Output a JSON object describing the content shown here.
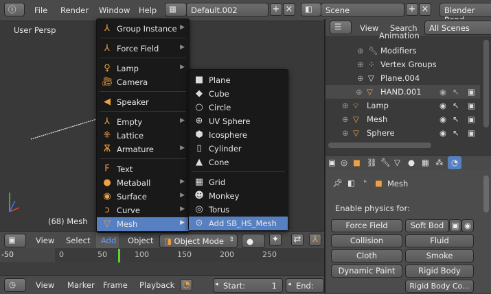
{
  "topbar": {
    "menus": [
      "File",
      "Render",
      "Window",
      "Help"
    ],
    "layout_field": "Default.002",
    "scene_field": "Scene",
    "engine_field": "Blender Rend"
  },
  "viewport": {
    "view_label": "User Persp",
    "object_label": "(68) Mesh"
  },
  "view_header": {
    "items": [
      "View",
      "Select",
      "Add",
      "Object"
    ],
    "mode": "Object Mode"
  },
  "timeline": {
    "ticks": [
      "-50",
      "0",
      "50",
      "100",
      "150",
      "200",
      "250"
    ],
    "current_frame_marker": 68,
    "footer_items": [
      "View",
      "Marker",
      "Frame",
      "Playback"
    ],
    "start_label": "Start:",
    "start_value": "1",
    "end_label": "End:"
  },
  "outliner": {
    "header_items": [
      "View",
      "Search"
    ],
    "scope": "All Scenes",
    "rows": [
      {
        "label": "Animation",
        "icon": "animation-icon"
      },
      {
        "label": "Modifiers",
        "icon": "wrench-icon"
      },
      {
        "label": "Vertex Groups",
        "icon": "vertex-groups-icon"
      },
      {
        "label": "Plane.004",
        "icon": "mesh-icon"
      },
      {
        "label": "HAND.001",
        "icon": "mesh-icon"
      },
      {
        "label": "Lamp",
        "icon": "lamp-icon"
      },
      {
        "label": "Mesh",
        "icon": "mesh-icon"
      },
      {
        "label": "Sphere",
        "icon": "mesh-icon"
      }
    ]
  },
  "properties": {
    "breadcrumb": "Mesh",
    "section_label": "Enable physics for:",
    "buttons": [
      "Force Field",
      "Soft Bod",
      "Collision",
      "Fluid",
      "Cloth",
      "Smoke",
      "Dynamic Paint",
      "Rigid Body",
      "Rigid Body Co..."
    ]
  },
  "add_menu": {
    "items": [
      {
        "label": "Group Instance",
        "icon": "group-instance-icon",
        "submenu": true
      },
      {
        "label": "Force Field",
        "icon": "force-field-icon",
        "submenu": true
      },
      {
        "label": "Lamp",
        "icon": "lamp-icon",
        "submenu": true
      },
      {
        "label": "Camera",
        "icon": "camera-icon",
        "submenu": false
      },
      {
        "label": "Speaker",
        "icon": "speaker-icon",
        "submenu": false
      },
      {
        "label": "Empty",
        "icon": "empty-icon",
        "submenu": true
      },
      {
        "label": "Lattice",
        "icon": "lattice-icon",
        "submenu": false
      },
      {
        "label": "Armature",
        "icon": "armature-icon",
        "submenu": true
      },
      {
        "label": "Text",
        "icon": "text-icon",
        "submenu": false
      },
      {
        "label": "Metaball",
        "icon": "metaball-icon",
        "submenu": true
      },
      {
        "label": "Surface",
        "icon": "surface-icon",
        "submenu": true
      },
      {
        "label": "Curve",
        "icon": "curve-icon",
        "submenu": true
      },
      {
        "label": "Mesh",
        "icon": "mesh-icon",
        "submenu": true
      }
    ]
  },
  "mesh_menu": {
    "items": [
      {
        "label": "Plane",
        "icon": "plane-icon"
      },
      {
        "label": "Cube",
        "icon": "cube-icon"
      },
      {
        "label": "Circle",
        "icon": "circle-icon"
      },
      {
        "label": "UV Sphere",
        "icon": "uv-sphere-icon"
      },
      {
        "label": "Icosphere",
        "icon": "icosphere-icon"
      },
      {
        "label": "Cylinder",
        "icon": "cylinder-icon"
      },
      {
        "label": "Cone",
        "icon": "cone-icon"
      },
      {
        "label": "Grid",
        "icon": "grid-icon"
      },
      {
        "label": "Monkey",
        "icon": "monkey-icon"
      },
      {
        "label": "Torus",
        "icon": "torus-icon"
      },
      {
        "label": "Add SB_HS_Mesh",
        "icon": "add-mesh-icon"
      }
    ]
  },
  "colors": {
    "accent": "#5680c2",
    "icon_orange": "#f0a040",
    "timeline_marker": "#5ad23c"
  }
}
